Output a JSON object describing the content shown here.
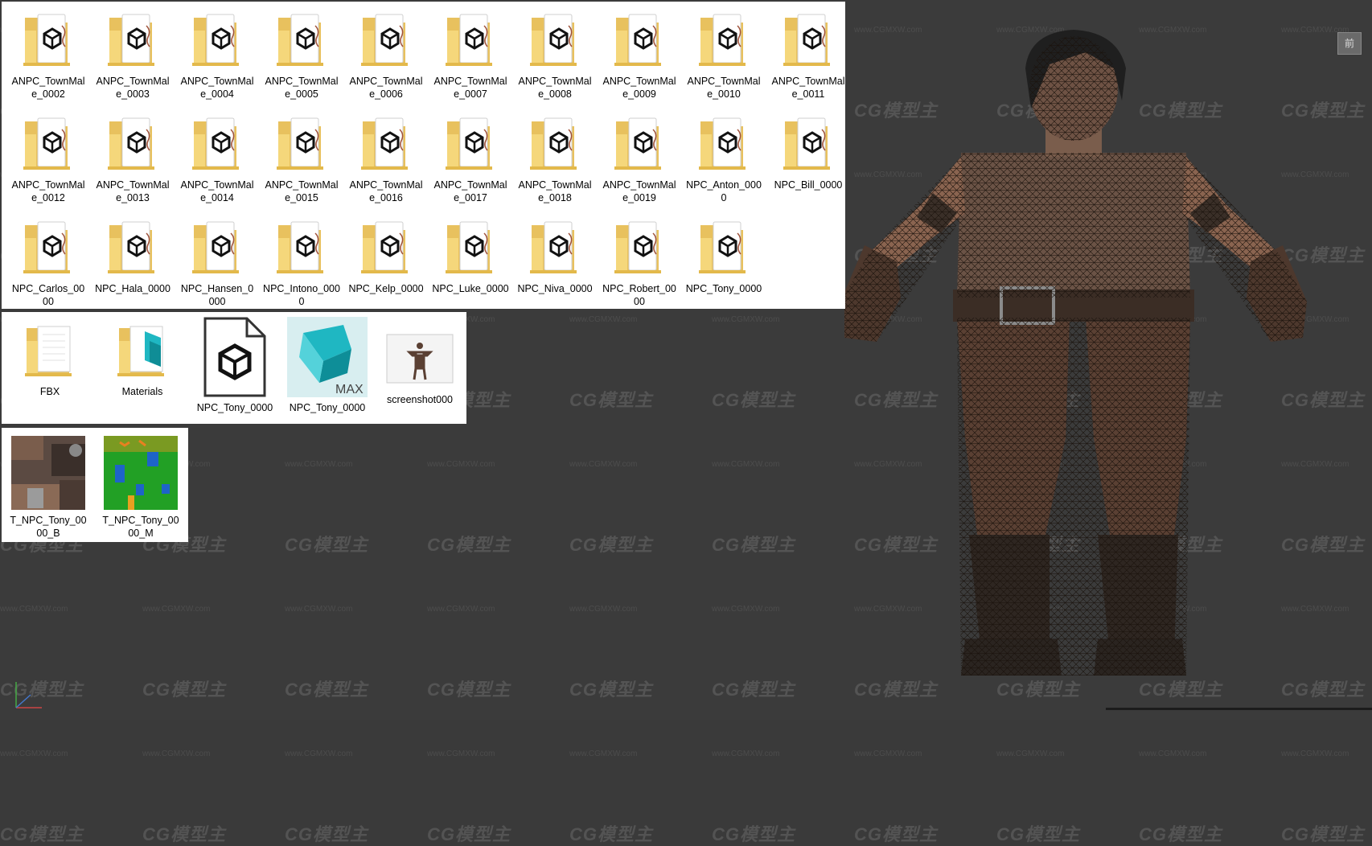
{
  "folders_panel": {
    "items": [
      {
        "label": "ANPC_TownMale_0002"
      },
      {
        "label": "ANPC_TownMale_0003"
      },
      {
        "label": "ANPC_TownMale_0004"
      },
      {
        "label": "ANPC_TownMale_0005"
      },
      {
        "label": "ANPC_TownMale_0006"
      },
      {
        "label": "ANPC_TownMale_0007"
      },
      {
        "label": "ANPC_TownMale_0008"
      },
      {
        "label": "ANPC_TownMale_0009"
      },
      {
        "label": "ANPC_TownMale_0010"
      },
      {
        "label": "ANPC_TownMale_0011"
      },
      {
        "label": "ANPC_TownMale_0012"
      },
      {
        "label": "ANPC_TownMale_0013"
      },
      {
        "label": "ANPC_TownMale_0014"
      },
      {
        "label": "ANPC_TownMale_0015"
      },
      {
        "label": "ANPC_TownMale_0016"
      },
      {
        "label": "ANPC_TownMale_0017"
      },
      {
        "label": "ANPC_TownMale_0018"
      },
      {
        "label": "ANPC_TownMale_0019"
      },
      {
        "label": "NPC_Anton_0000"
      },
      {
        "label": "NPC_Bill_0000"
      },
      {
        "label": "NPC_Carlos_0000"
      },
      {
        "label": "NPC_Hala_0000"
      },
      {
        "label": "NPC_Hansen_0000"
      },
      {
        "label": "NPC_Intono_0000"
      },
      {
        "label": "NPC_Kelp_0000"
      },
      {
        "label": "NPC_Luke_0000"
      },
      {
        "label": "NPC_Niva_0000"
      },
      {
        "label": "NPC_Robert_0000"
      },
      {
        "label": "NPC_Tony_0000"
      }
    ]
  },
  "files_panel": {
    "items": [
      {
        "label": "FBX",
        "icon": "folder-icon"
      },
      {
        "label": "Materials",
        "icon": "folder-icon"
      },
      {
        "label": "NPC_Tony_0000",
        "icon": "fbx-file-icon"
      },
      {
        "label": "NPC_Tony_0000",
        "icon": "3dsmax-file-icon",
        "badge": "MAX"
      },
      {
        "label": "screenshot000",
        "icon": "image-thumbnail"
      }
    ]
  },
  "textures_panel": {
    "items": [
      {
        "label": "T_NPC_Tony_0000_B"
      },
      {
        "label": "T_NPC_Tony_0000_M"
      }
    ]
  },
  "viewport": {
    "view_label": "前",
    "watermark_text": "CG模型主",
    "watermark_url": "www.CGMXW.com"
  },
  "colors": {
    "viewport_bg": "#3b3b3b",
    "folder_yellow": "#f5d77b",
    "max_teal": "#1fb7c2"
  }
}
